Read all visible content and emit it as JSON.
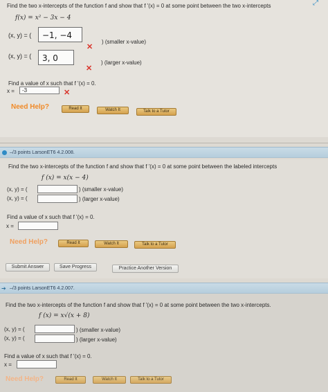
{
  "q1": {
    "prompt": "Find the two x-intercepts of the function f and show that f '(x) = 0 at some point between the two x-intercepts",
    "function": "f(x) = x² − 3x − 4",
    "xy_label_1": "(x, y) = (",
    "answer_1": "−1, −4",
    "suffix_1": ") (smaller x-value)",
    "xy_label_2": "(x, y) = (",
    "answer_2": "3, 0",
    "suffix_2": ") (larger x-value)",
    "find_prompt": "Find a value of x such that f '(x) = 0.",
    "x_label": "x =",
    "x_answer": "-3",
    "wrong_mark": "✕",
    "need_help": "Need Help?",
    "read_it": "Read It",
    "watch_it": "Watch It",
    "talk_tutor": "Talk to a Tutor"
  },
  "q2": {
    "points": "–/3 points   LarsonET6 4.2.008.",
    "prompt": "Find the two x-intercepts of the function f and show that f '(x) = 0 at some point between the labeled intercepts",
    "function": "f (x) = x(x − 4)",
    "xy_label_1": "(x, y) = (",
    "suffix_1": ") (smaller x-value)",
    "xy_label_2": "(x, y) = (",
    "suffix_2": ") (larger x-value)",
    "find_prompt": "Find a value of x such that f '(x) = 0.",
    "x_label": "x =",
    "need_help": "Need Help?",
    "read_it": "Read It",
    "watch_it": "Watch It",
    "talk_tutor": "Talk to a Tutor",
    "submit": "Submit Answer",
    "save": "Save Progress",
    "practice": "Practice Another Version"
  },
  "q3": {
    "points": "–/3 points   LarsonET6 4.2.007.",
    "prompt": "Find the two x-intercepts of the function f and show that f '(x) = 0 at some point between the two x-intercepts.",
    "function": "f (x) = x√(x + 8)",
    "xy_label_1": "(x, y) = (",
    "suffix_1": ") (smaller x-value)",
    "xy_label_2": "(x, y) = (",
    "suffix_2": ") (larger x-value)",
    "find_prompt": "Find a value of x such that f '(x) = 0.",
    "x_label": "x =",
    "need_help": "Need Help?",
    "read_it": "Read It",
    "watch_it": "Watch It",
    "talk_tutor": "Talk to a Tutor"
  }
}
